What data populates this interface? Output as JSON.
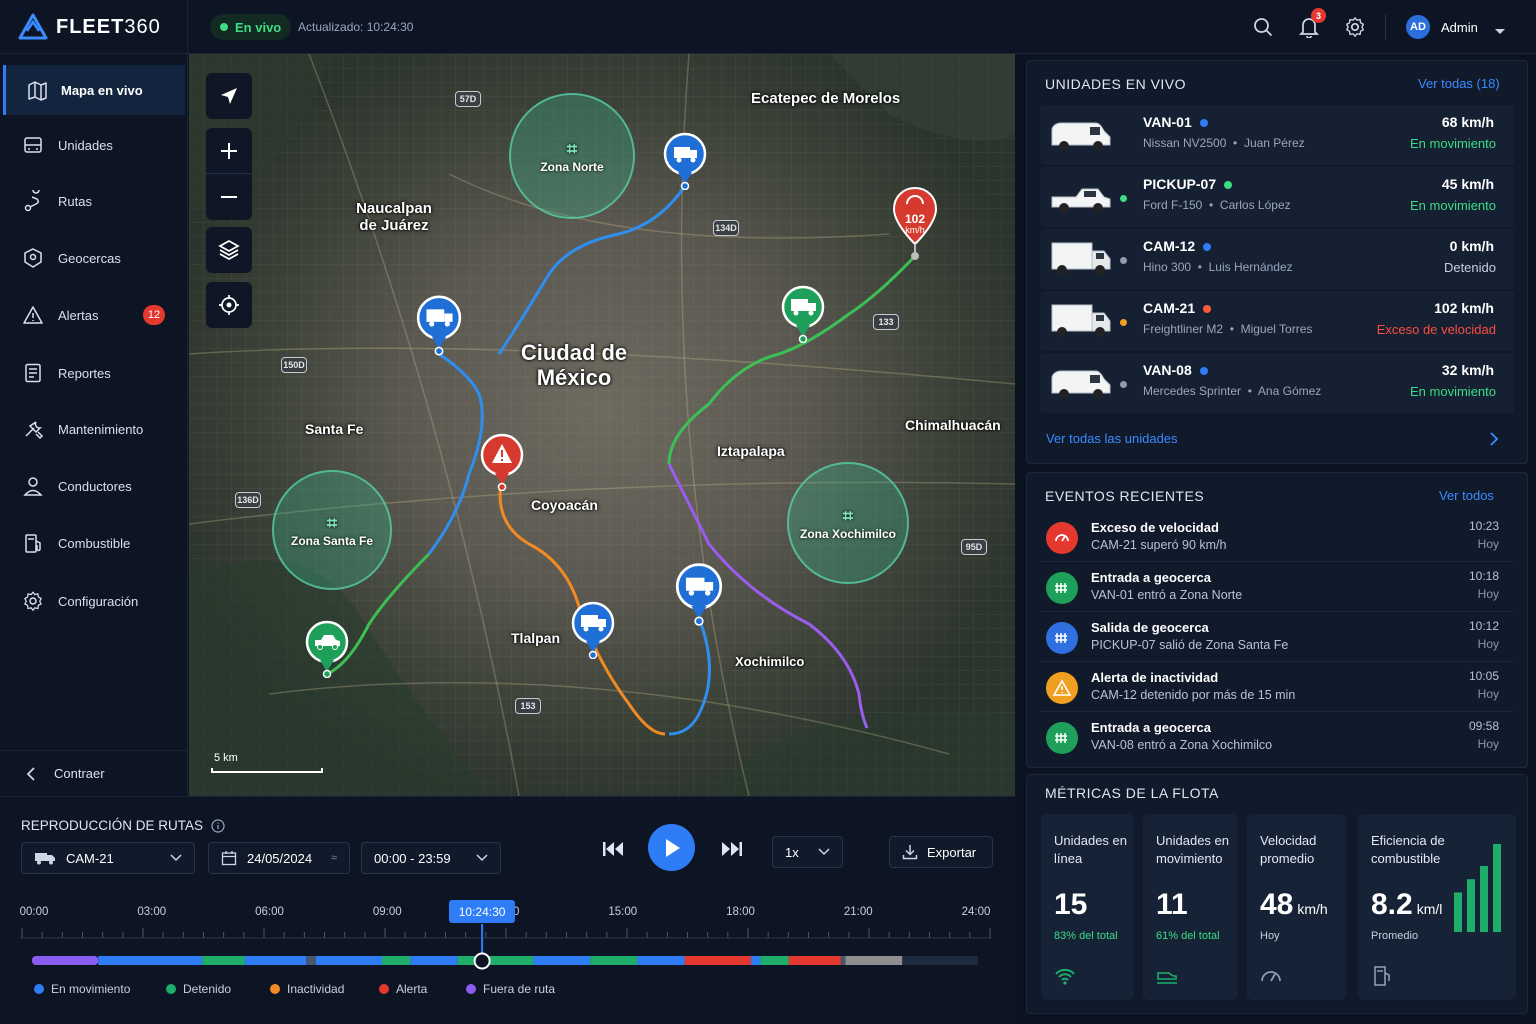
{
  "app": {
    "brand_bold": "FLEET",
    "brand_light": "360"
  },
  "topbar": {
    "live_label": "En vivo",
    "updated": "Actualizado: 10:24:30",
    "notifications": "3",
    "avatar_initials": "AD",
    "user": "Admin"
  },
  "sidebar": {
    "items": [
      {
        "label": "Mapa en vivo",
        "icon": "map-icon",
        "active": true
      },
      {
        "label": "Unidades",
        "icon": "bus-icon"
      },
      {
        "label": "Rutas",
        "icon": "route-icon"
      },
      {
        "label": "Geocercas",
        "icon": "geofence-icon"
      },
      {
        "label": "Alertas",
        "icon": "alert-icon",
        "badge": "12"
      },
      {
        "label": "Reportes",
        "icon": "report-icon"
      },
      {
        "label": "Mantenimiento",
        "icon": "wrench-icon"
      },
      {
        "label": "Conductores",
        "icon": "person-icon"
      },
      {
        "label": "Combustible",
        "icon": "fuel-icon"
      },
      {
        "label": "Configuración",
        "icon": "gear-icon"
      }
    ],
    "collapse": "Contraer"
  },
  "map": {
    "labels": [
      "Ecatepec de Morelos",
      "Naucalpan de Juárez",
      "Ciudad de México",
      "Santa Fe",
      "Chimalhuacán",
      "Iztapalapa",
      "Coyoacán",
      "Tlalpan",
      "Xochimilco"
    ],
    "zones": [
      "Zona Norte",
      "Zona Santa Fe",
      "Zona Xochimilco"
    ],
    "shields": [
      "57D",
      "134D",
      "133",
      "150D",
      "136D",
      "95D",
      "153"
    ],
    "speed_pin": {
      "value": "102",
      "unit": "km/h"
    },
    "scale": "5 km"
  },
  "units_panel": {
    "title": "UNIDADES EN VIVO",
    "view_all": "Ver todas (18)",
    "footer": "Ver todas las unidades",
    "units": [
      {
        "name": "VAN-01",
        "model": "Nissan NV2500",
        "driver": "Juan Pérez",
        "speed": "68 km/h",
        "status": "En movimiento",
        "status_color": "#3ddc84",
        "dot": "#2f7df6",
        "type": "van"
      },
      {
        "name": "PICKUP-07",
        "model": "Ford F-150",
        "driver": "Carlos López",
        "speed": "45 km/h",
        "status": "En movimiento",
        "status_color": "#3ddc84",
        "dot": "#3ddc84",
        "type": "pickup"
      },
      {
        "name": "CAM-12",
        "model": "Hino 300",
        "driver": "Luis Hernández",
        "speed": "0 km/h",
        "status": "Detenido",
        "status_color": "#c7d0de",
        "dot": "#2f7df6",
        "type": "truck"
      },
      {
        "name": "CAM-21",
        "model": "Freightliner M2",
        "driver": "Miguel Torres",
        "speed": "102 km/h",
        "status": "Exceso de velocidad",
        "status_color": "#ff4b3e",
        "dot": "#ff5a3c",
        "type": "truck"
      },
      {
        "name": "VAN-08",
        "model": "Mercedes Sprinter",
        "driver": "Ana Gómez",
        "speed": "32 km/h",
        "status": "En movimiento",
        "status_color": "#3ddc84",
        "dot": "#2f7df6",
        "type": "van"
      }
    ]
  },
  "events_panel": {
    "title": "EVENTOS RECIENTES",
    "view_all": "Ver todos",
    "events": [
      {
        "title": "Exceso de velocidad",
        "desc": "CAM-21 superó 90 km/h",
        "time": "10:23",
        "day": "Hoy",
        "color": "#e5382e",
        "icon": "speedometer-icon"
      },
      {
        "title": "Entrada a geocerca",
        "desc": "VAN-01 entró a Zona Norte",
        "time": "10:18",
        "day": "Hoy",
        "color": "#1fa05a",
        "icon": "geofence-icon"
      },
      {
        "title": "Salida de geocerca",
        "desc": "PICKUP-07 salió de Zona Santa Fe",
        "time": "10:12",
        "day": "Hoy",
        "color": "#2f6fe0",
        "icon": "geofence-icon"
      },
      {
        "title": "Alerta de inactividad",
        "desc": "CAM-12 detenido por más de 15 min",
        "time": "10:05",
        "day": "Hoy",
        "color": "#f0a020",
        "icon": "warning-icon"
      },
      {
        "title": "Entrada a geocerca",
        "desc": "VAN-08 entró a Zona Xochimilco",
        "time": "09:58",
        "day": "Hoy",
        "color": "#1fa05a",
        "icon": "geofence-icon"
      }
    ]
  },
  "metrics_panel": {
    "title": "MÉTRICAS DE LA FLOTA",
    "metrics": [
      {
        "title": "Unidades en línea",
        "value": "15",
        "unit": "",
        "sub": "83% del total",
        "sub_color": "#3ddc84"
      },
      {
        "title": "Unidades en movimiento",
        "value": "11",
        "unit": "",
        "sub": "61% del total",
        "sub_color": "#3ddc84"
      },
      {
        "title": "Velocidad promedio",
        "value": "48",
        "unit": "km/h",
        "sub": "Hoy",
        "sub_color": "#c7d0de"
      },
      {
        "title": "Eficiencia de combustible",
        "value": "8.2",
        "unit": "km/l",
        "sub": "Promedio",
        "sub_color": "#c7d0de"
      }
    ],
    "efficiency_bars": [
      0.45,
      0.6,
      0.75,
      1.0
    ]
  },
  "playback": {
    "title": "REPRODUCCIÓN DE RUTAS",
    "vehicle": "CAM-21",
    "date": "24/05/2024",
    "range": "00:00 - 23:59",
    "speed": "1x",
    "export": "Exportar",
    "current_time": "10:24:30",
    "progress": 0.4757,
    "ticks": [
      "00:00",
      "03:00",
      "06:00",
      "09:00",
      "12:00",
      "15:00",
      "18:00",
      "21:00",
      "24:00"
    ],
    "legend": [
      {
        "label": "En movimiento",
        "color": "#2f7df6"
      },
      {
        "label": "Detenido",
        "color": "#1fae6a"
      },
      {
        "label": "Inactividad",
        "color": "#f08a24"
      },
      {
        "label": "Alerta",
        "color": "#e5382e"
      },
      {
        "label": "Fuera de ruta",
        "color": "#8a5cf0"
      }
    ]
  }
}
